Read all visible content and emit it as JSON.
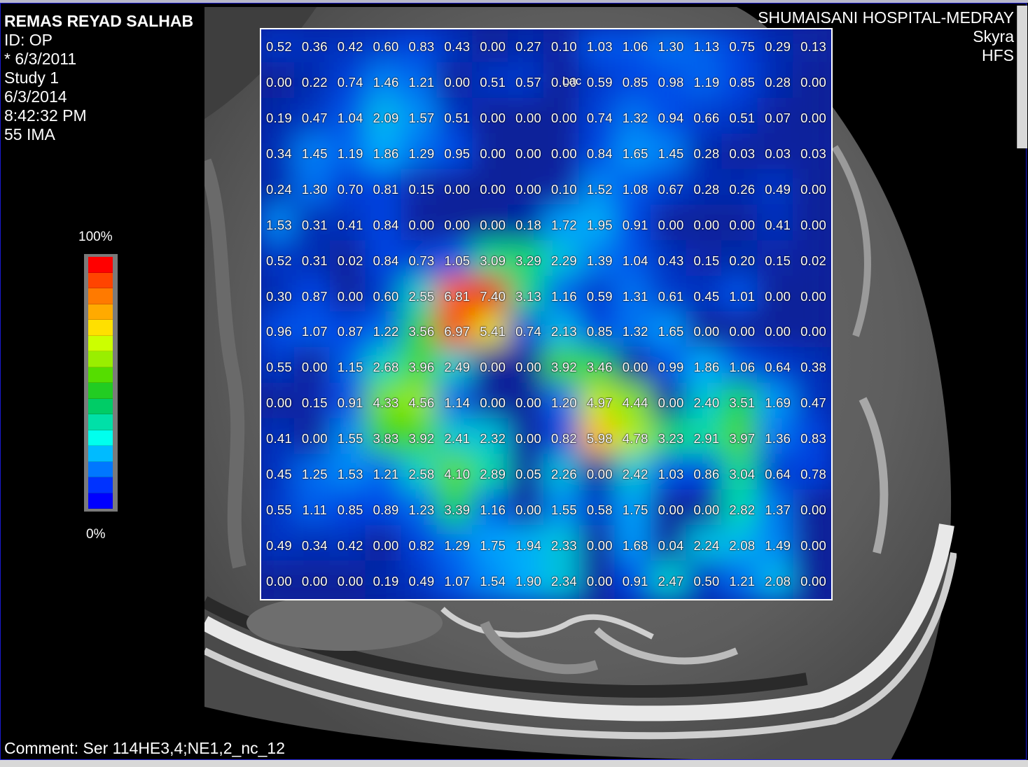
{
  "patient": {
    "name": "REMAS REYAD SALHAB",
    "id": "ID: OP",
    "birth": "* 6/3/2011",
    "study": "Study 1",
    "date": "6/3/2014",
    "time": "8:42:32 PM",
    "image": "55 IMA"
  },
  "institution": {
    "name": "SHUMAISANI HOSPITAL-MEDRAY",
    "model": "Skyra",
    "position": "HFS"
  },
  "comment": "Comment: Ser 114HE3,4;NE1,2_nc_12",
  "color_scale": {
    "max_label": "100%",
    "min_label": "0%",
    "colors": [
      "#ff0000",
      "#ff4400",
      "#ff7a00",
      "#ffaa00",
      "#ffe000",
      "#ccff00",
      "#99ee00",
      "#55dd00",
      "#22cc22",
      "#00cc66",
      "#00e0a8",
      "#00ffee",
      "#00bbff",
      "#0077ff",
      "#0033ff",
      "#0000ff"
    ]
  },
  "metabolite_label": "Lac",
  "grid": [
    [
      "0.52",
      "0.36",
      "0.42",
      "0.60",
      "0.83",
      "0.43",
      "0.00",
      "0.27",
      "0.10",
      "1.03",
      "1.06",
      "1.30",
      "1.13",
      "0.75",
      "0.29",
      "0.13"
    ],
    [
      "0.00",
      "0.22",
      "0.74",
      "1.46",
      "1.21",
      "0.00",
      "0.51",
      "0.57",
      "0.00",
      "0.59",
      "0.85",
      "0.98",
      "1.19",
      "0.85",
      "0.28",
      "0.00"
    ],
    [
      "0.19",
      "0.47",
      "1.04",
      "2.09",
      "1.57",
      "0.51",
      "0.00",
      "0.00",
      "0.00",
      "0.74",
      "1.32",
      "0.94",
      "0.66",
      "0.51",
      "0.07",
      "0.00"
    ],
    [
      "0.34",
      "1.45",
      "1.19",
      "1.86",
      "1.29",
      "0.95",
      "0.00",
      "0.00",
      "0.00",
      "0.84",
      "1.65",
      "1.45",
      "0.28",
      "0.03",
      "0.03",
      "0.03"
    ],
    [
      "0.24",
      "1.30",
      "0.70",
      "0.81",
      "0.15",
      "0.00",
      "0.00",
      "0.00",
      "0.10",
      "1.52",
      "1.08",
      "0.67",
      "0.28",
      "0.26",
      "0.49",
      "0.00"
    ],
    [
      "1.53",
      "0.31",
      "0.41",
      "0.84",
      "0.00",
      "0.00",
      "0.00",
      "0.18",
      "1.72",
      "1.95",
      "0.91",
      "0.00",
      "0.00",
      "0.00",
      "0.41",
      "0.00"
    ],
    [
      "0.52",
      "0.31",
      "0.02",
      "0.84",
      "0.73",
      "1.05",
      "3.09",
      "3.29",
      "2.29",
      "1.39",
      "1.04",
      "0.43",
      "0.15",
      "0.20",
      "0.15",
      "0.02"
    ],
    [
      "0.30",
      "0.87",
      "0.00",
      "0.60",
      "2.55",
      "6.81",
      "7.40",
      "3.13",
      "1.16",
      "0.59",
      "1.31",
      "0.61",
      "0.45",
      "1.01",
      "0.00",
      "0.00"
    ],
    [
      "0.96",
      "1.07",
      "0.87",
      "1.22",
      "3.56",
      "6.97",
      "5.41",
      "0.74",
      "2.13",
      "0.85",
      "1.32",
      "1.65",
      "0.00",
      "0.00",
      "0.00",
      "0.00"
    ],
    [
      "0.55",
      "0.00",
      "1.15",
      "2.68",
      "3.96",
      "2.49",
      "0.00",
      "0.00",
      "3.92",
      "3.46",
      "0.00",
      "0.99",
      "1.86",
      "1.06",
      "0.64",
      "0.38"
    ],
    [
      "0.00",
      "0.15",
      "0.91",
      "4.33",
      "4.56",
      "1.14",
      "0.00",
      "0.00",
      "1.20",
      "4.97",
      "4.44",
      "0.00",
      "2.40",
      "3.51",
      "1.69",
      "0.47"
    ],
    [
      "0.41",
      "0.00",
      "1.55",
      "3.83",
      "3.92",
      "2.41",
      "2.32",
      "0.00",
      "0.82",
      "5.98",
      "4.78",
      "3.23",
      "2.91",
      "3.97",
      "1.36",
      "0.83"
    ],
    [
      "0.45",
      "1.25",
      "1.53",
      "1.21",
      "2.58",
      "4.10",
      "2.89",
      "0.05",
      "2.26",
      "0.00",
      "2.42",
      "1.03",
      "0.86",
      "3.04",
      "0.64",
      "0.78"
    ],
    [
      "0.55",
      "1.11",
      "0.85",
      "0.89",
      "1.23",
      "3.39",
      "1.16",
      "0.00",
      "1.55",
      "0.58",
      "1.75",
      "0.00",
      "0.00",
      "2.82",
      "1.37",
      "0.00"
    ],
    [
      "0.49",
      "0.34",
      "0.42",
      "0.00",
      "0.82",
      "1.29",
      "1.75",
      "1.94",
      "2.33",
      "0.00",
      "1.68",
      "0.04",
      "2.24",
      "2.08",
      "1.49",
      "0.00"
    ],
    [
      "0.00",
      "0.00",
      "0.00",
      "0.19",
      "0.49",
      "1.07",
      "1.54",
      "1.90",
      "2.34",
      "0.00",
      "0.91",
      "2.47",
      "0.50",
      "1.21",
      "2.08",
      "0.00"
    ]
  ]
}
